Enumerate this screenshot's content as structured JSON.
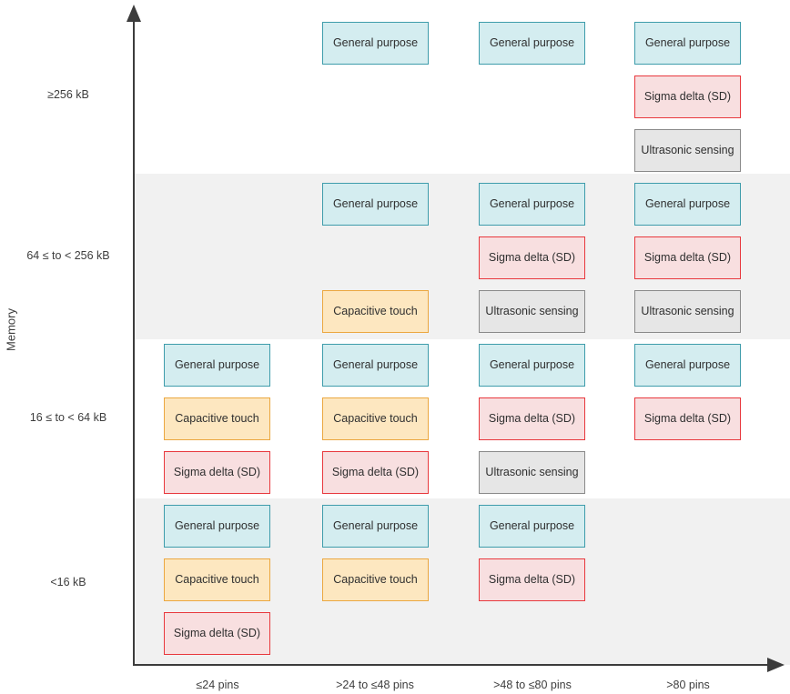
{
  "chart_data": {
    "type": "table",
    "title": "",
    "xlabel": "",
    "ylabel": "Memory",
    "grid": false,
    "legend": "none",
    "x_categories": [
      "≤24 pins",
      ">24 to ≤48 pins",
      ">48 to ≤80 pins",
      ">80 pins"
    ],
    "y_categories": [
      "≥256 kB",
      "64 ≤ to < 256 kB",
      "16 ≤ to < 64 kB",
      "<16 kB"
    ],
    "item_types": [
      {
        "key": "general",
        "label": "General purpose",
        "fill": "#d4edf0",
        "border": "#3e9cab"
      },
      {
        "key": "sigma",
        "label": "Sigma delta (SD)",
        "fill": "#f8dfe0",
        "border": "#e8383d"
      },
      {
        "key": "captouch",
        "label": "Capacitive touch",
        "fill": "#fde7c0",
        "border": "#eba740"
      },
      {
        "key": "ultra",
        "label": "Ultrasonic sensing",
        "fill": "#e6e6e6",
        "border": "#8a8a8a"
      }
    ],
    "cells": [
      {
        "row": "≥256 kB",
        "col": "≤24 pins",
        "slots": [
          null,
          null,
          null
        ]
      },
      {
        "row": "≥256 kB",
        "col": ">24 to ≤48 pins",
        "slots": [
          "General purpose",
          null,
          null
        ]
      },
      {
        "row": "≥256 kB",
        "col": ">48 to ≤80 pins",
        "slots": [
          "General purpose",
          null,
          null
        ]
      },
      {
        "row": "≥256 kB",
        "col": ">80 pins",
        "slots": [
          "General purpose",
          "Sigma delta (SD)",
          "Ultrasonic sensing"
        ]
      },
      {
        "row": "64 ≤ to < 256 kB",
        "col": "≤24 pins",
        "slots": [
          null,
          null,
          null
        ]
      },
      {
        "row": "64 ≤ to < 256 kB",
        "col": ">24 to ≤48 pins",
        "slots": [
          "General purpose",
          null,
          "Capacitive touch"
        ]
      },
      {
        "row": "64 ≤ to < 256 kB",
        "col": ">48 to ≤80 pins",
        "slots": [
          "General purpose",
          "Sigma delta (SD)",
          "Ultrasonic sensing"
        ]
      },
      {
        "row": "64 ≤ to < 256 kB",
        "col": ">80 pins",
        "slots": [
          "General purpose",
          "Sigma delta (SD)",
          "Ultrasonic sensing"
        ]
      },
      {
        "row": "16 ≤ to < 64 kB",
        "col": "≤24 pins",
        "slots": [
          "General purpose",
          "Capacitive touch",
          "Sigma delta (SD)"
        ]
      },
      {
        "row": "16 ≤ to < 64 kB",
        "col": ">24 to ≤48 pins",
        "slots": [
          "General purpose",
          "Capacitive touch",
          "Sigma delta (SD)"
        ]
      },
      {
        "row": "16 ≤ to < 64 kB",
        "col": ">48 to ≤80 pins",
        "slots": [
          "General purpose",
          "Sigma delta (SD)",
          "Ultrasonic sensing"
        ]
      },
      {
        "row": "16 ≤ to < 64 kB",
        "col": ">80 pins",
        "slots": [
          "General purpose",
          "Sigma delta (SD)",
          null
        ]
      },
      {
        "row": "<16 kB",
        "col": "≤24 pins",
        "slots": [
          "General purpose",
          "Capacitive touch",
          "Sigma delta (SD)"
        ]
      },
      {
        "row": "<16 kB",
        "col": ">24 to ≤48 pins",
        "slots": [
          "General purpose",
          "Capacitive touch",
          null
        ]
      },
      {
        "row": "<16 kB",
        "col": ">48 to ≤80 pins",
        "slots": [
          "General purpose",
          "Sigma delta (SD)",
          null
        ]
      },
      {
        "row": "<16 kB",
        "col": ">80 pins",
        "slots": [
          null,
          null,
          null
        ]
      }
    ]
  },
  "layout": {
    "band_color": "#f1f1f1",
    "axis_color": "#3c3c3c",
    "banded_rows": [
      "64 ≤ to < 256 kB",
      "<16 kB"
    ]
  }
}
